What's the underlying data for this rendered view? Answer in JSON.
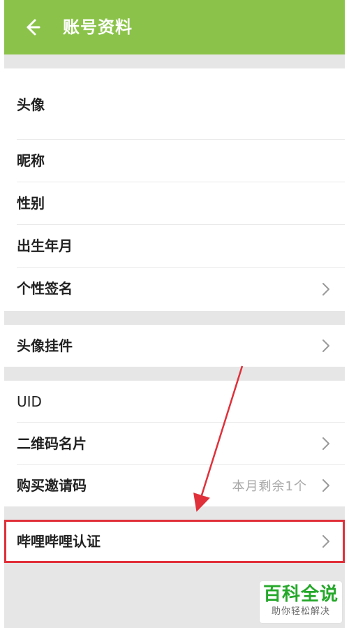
{
  "header": {
    "title": "账号资料"
  },
  "sections": {
    "profile": {
      "rows": [
        {
          "label": "头像"
        },
        {
          "label": "昵称"
        },
        {
          "label": "性别"
        },
        {
          "label": "出生年月"
        },
        {
          "label": "个性签名"
        }
      ]
    },
    "decor": {
      "rows": [
        {
          "label": "头像挂件"
        }
      ]
    },
    "account": {
      "rows": [
        {
          "label": "UID"
        },
        {
          "label": "二维码名片"
        },
        {
          "label": "购买邀请码",
          "value": "本月剩余1个"
        }
      ]
    },
    "cert": {
      "rows": [
        {
          "label": "哔哩哔哩认证"
        }
      ]
    }
  },
  "watermark": {
    "title": "百科全说",
    "subtitle": "助你轻松解决"
  },
  "colors": {
    "accent_green": "#8BC34A",
    "highlight_red": "#E0303A"
  },
  "icons": {
    "back": "arrow-left-icon",
    "chevron": "chevron-right-icon"
  }
}
